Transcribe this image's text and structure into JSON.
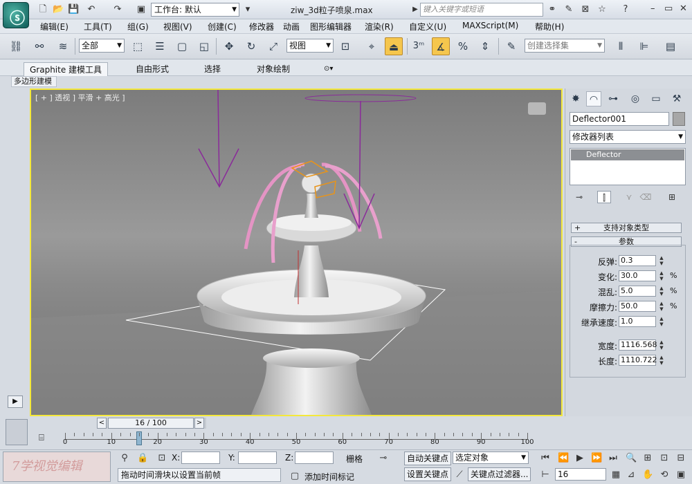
{
  "titlebar": {
    "workspace_label": "工作台: 默认",
    "file_title": "ziw_3d粒子喷泉.max",
    "search_placeholder": "键入关键字或短语"
  },
  "menu": [
    "编辑(E)",
    "工具(T)",
    "组(G)",
    "视图(V)",
    "创建(C)",
    "修改器",
    "动画",
    "图形编辑器",
    "渲染(R)",
    "自定义(U)",
    "MAXScript(M)",
    "帮助(H)"
  ],
  "toolbar": {
    "selection_filter": "全部",
    "ref_coord": "视图",
    "named_selection": "创建选择集",
    "snap_label": "3"
  },
  "ribbon": {
    "tabs": [
      "Graphite 建模工具",
      "自由形式",
      "选择",
      "对象绘制"
    ],
    "active_tab": "Graphite 建模工具",
    "subpanel": "多边形建模"
  },
  "viewport": {
    "label": "[ + ] 透视 ] 平滑 + 高光 ]"
  },
  "command_panel": {
    "object_name": "Deflector001",
    "modifier_list": "修改器列表",
    "stack_item": "Deflector",
    "rollouts": [
      "支持对象类型",
      "参数"
    ],
    "params": [
      {
        "label": "反弹:",
        "value": "0.3",
        "unit": ""
      },
      {
        "label": "变化:",
        "value": "30.0",
        "unit": "%"
      },
      {
        "label": "混乱:",
        "value": "5.0",
        "unit": "%"
      },
      {
        "label": "摩擦力:",
        "value": "50.0",
        "unit": "%"
      },
      {
        "label": "继承速度:",
        "value": "1.0",
        "unit": ""
      },
      {
        "label": "宽度:",
        "value": "1116.568",
        "unit": ""
      },
      {
        "label": "长度:",
        "value": "1110.722",
        "unit": ""
      }
    ]
  },
  "timeline": {
    "frame_display": "16 / 100",
    "current_frame": 16,
    "total_frames": 100,
    "ruler_labels": [
      "0",
      "10",
      "20",
      "30",
      "40",
      "50",
      "60",
      "70",
      "80",
      "90",
      "100"
    ]
  },
  "status": {
    "x_label": "X:",
    "y_label": "Y:",
    "z_label": "Z:",
    "grid_label": "栅格",
    "auto_key": "自动关键点",
    "set_key": "设置关键点",
    "selected_objects": "选定对象",
    "key_filters": "关键点过滤器...",
    "prompt": "拖动时间滑块以设置当前帧",
    "add_time_tag": "添加时间标记",
    "frame_field": "16",
    "watermark": "7学视觉编辑"
  }
}
